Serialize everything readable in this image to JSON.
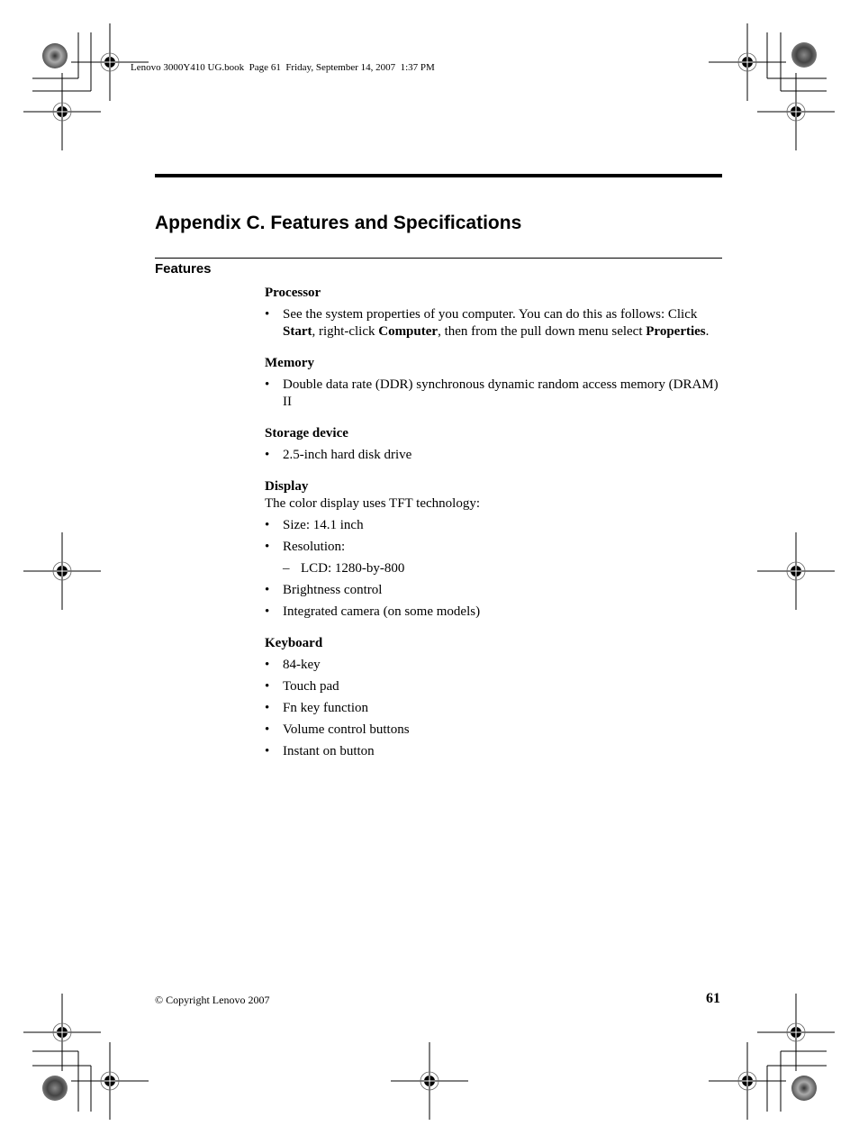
{
  "header": {
    "slug": "Lenovo 3000Y410 UG.book  Page 61  Friday, September 14, 2007  1:37 PM"
  },
  "page": {
    "title": "Appendix C. Features and Specifications",
    "section": "Features"
  },
  "groups": {
    "processor": {
      "heading": "Processor",
      "item_parts": [
        {
          "text": "See the system properties of you computer. You can do this as follows: Click ",
          "bold": false
        },
        {
          "text": "Start",
          "bold": true
        },
        {
          "text": ", right-click ",
          "bold": false
        },
        {
          "text": "Computer",
          "bold": true
        },
        {
          "text": ", then from the pull down menu select ",
          "bold": false
        },
        {
          "text": "Properties",
          "bold": true
        },
        {
          "text": ".",
          "bold": false
        }
      ]
    },
    "memory": {
      "heading": "Memory",
      "items": [
        "Double data rate (DDR) synchronous dynamic random access memory (DRAM) II"
      ]
    },
    "storage": {
      "heading": "Storage device",
      "items": [
        "2.5-inch hard disk drive"
      ]
    },
    "display": {
      "heading": "Display",
      "intro": "The color display uses TFT technology:",
      "items": [
        "Size: 14.1 inch",
        "Resolution:",
        "Brightness control",
        "Integrated camera (on some models)"
      ],
      "sub_items": [
        "LCD: 1280-by-800"
      ]
    },
    "keyboard": {
      "heading": "Keyboard",
      "items": [
        "84-key",
        "Touch pad",
        "Fn key function",
        "Volume control buttons",
        "Instant on button"
      ]
    }
  },
  "symbols": {
    "bullet": "•",
    "dash": "–"
  },
  "footer": {
    "copyright": "© Copyright Lenovo 2007",
    "page_number": "61"
  }
}
